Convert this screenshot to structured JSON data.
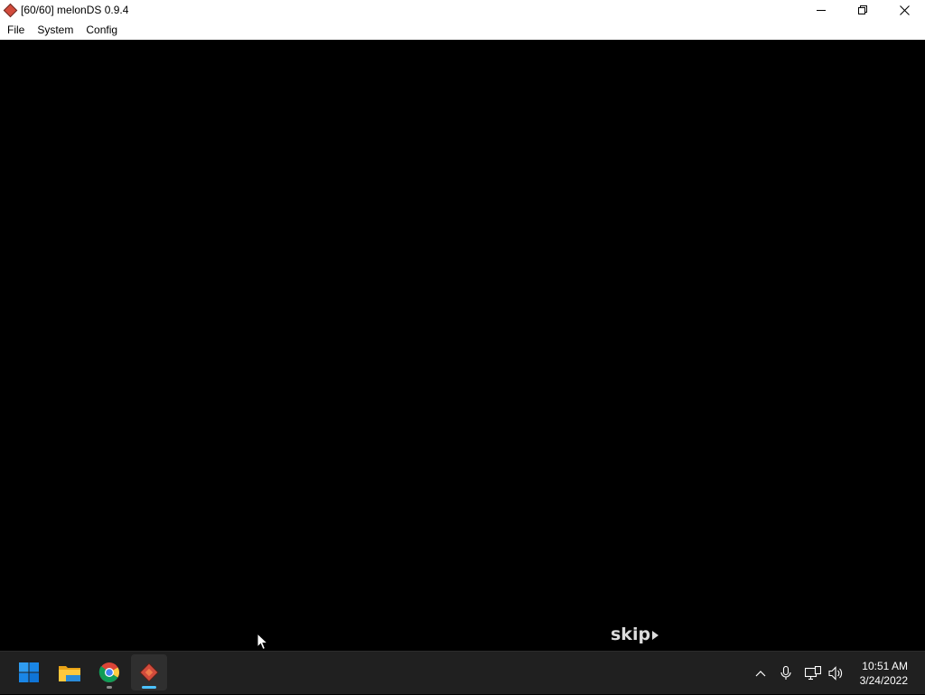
{
  "window": {
    "title": "[60/60] melonDS 0.9.4",
    "controls": [
      "minimize",
      "restore",
      "close"
    ]
  },
  "menu": {
    "items": [
      {
        "label": "File"
      },
      {
        "label": "System"
      },
      {
        "label": "Config"
      }
    ]
  },
  "screen": {
    "skip_label": "skip"
  },
  "taskbar": {
    "apps": [
      {
        "name": "start-icon"
      },
      {
        "name": "file-explorer-icon"
      },
      {
        "name": "chrome-icon"
      },
      {
        "name": "melonds-icon",
        "active": true
      }
    ],
    "tray_icons": [
      "chevron-up-icon",
      "microphone-icon",
      "network-icon",
      "volume-icon"
    ],
    "clock": {
      "time": "10:51 AM",
      "date": "3/24/2022"
    }
  },
  "colors": {
    "accent": "#4cc2ff",
    "taskbar": "#202020",
    "app_icon": "#d24b3c"
  }
}
